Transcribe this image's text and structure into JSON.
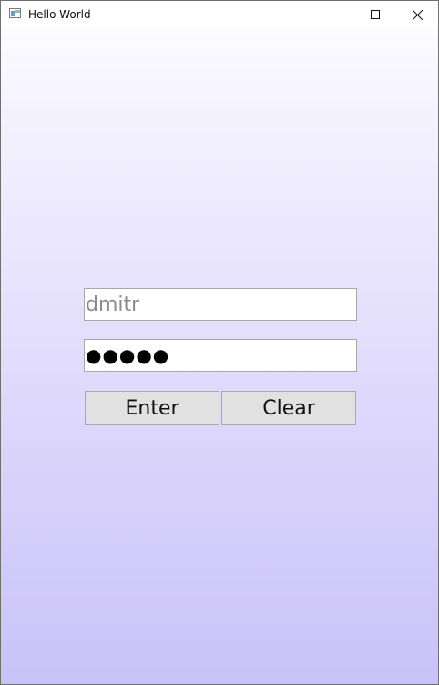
{
  "window": {
    "title": "Hello World",
    "icon": "app-window-icon",
    "controls": {
      "minimize_icon": "minimize-icon",
      "maximize_icon": "maximize-icon",
      "close_icon": "close-icon"
    }
  },
  "form": {
    "username": {
      "value": "dmitr"
    },
    "password": {
      "value": "●●●●●"
    },
    "enter_label": "Enter",
    "clear_label": "Clear"
  },
  "colors": {
    "gradient_top": "#ffffff",
    "gradient_bottom": "#c9c2f8",
    "button_face": "#e1e1e1",
    "field_border": "#a7a7a7",
    "username_text": "#8a8a8a"
  }
}
